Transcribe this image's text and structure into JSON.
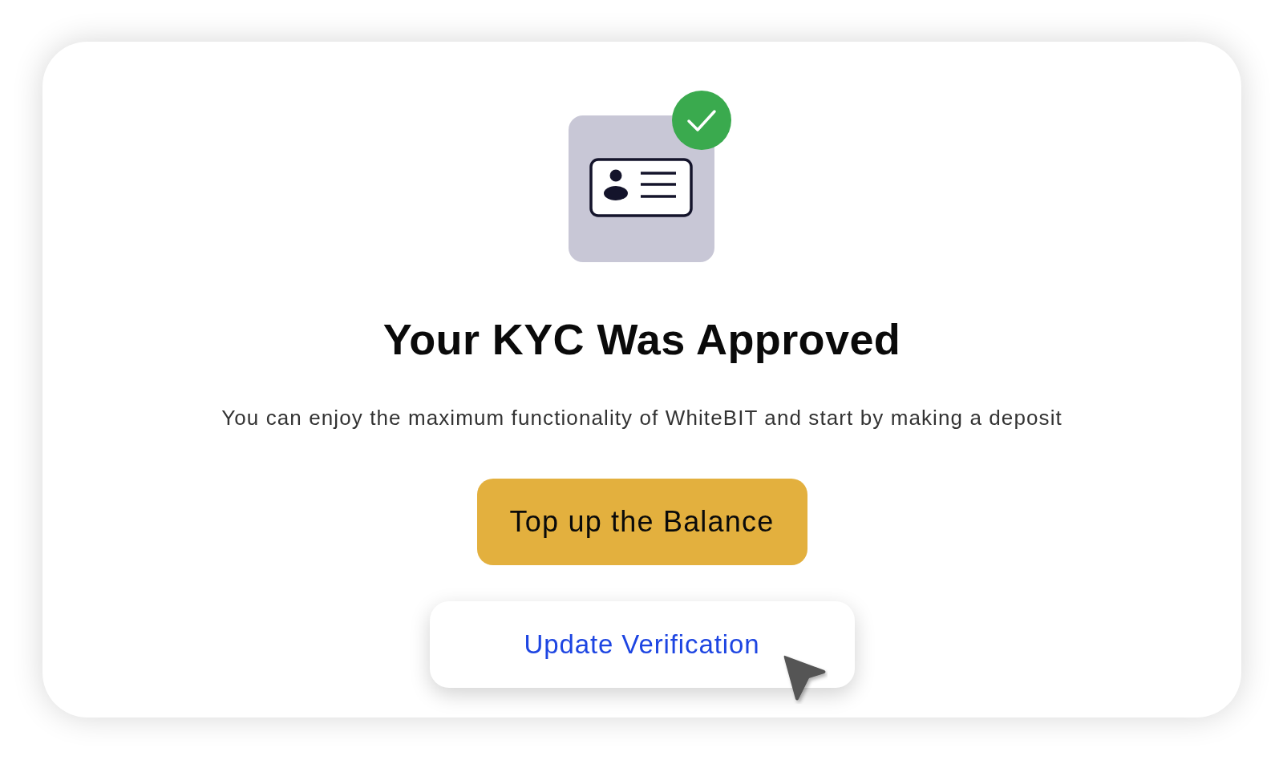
{
  "title": "Your KYC Was Approved",
  "description": "You can enjoy the maximum functionality of WhiteBIT and start by making a deposit",
  "buttons": [
    {
      "kind": "primary",
      "label": "Top up the Balance"
    },
    {
      "kind": "secondary",
      "label": "Update Verification"
    }
  ]
}
